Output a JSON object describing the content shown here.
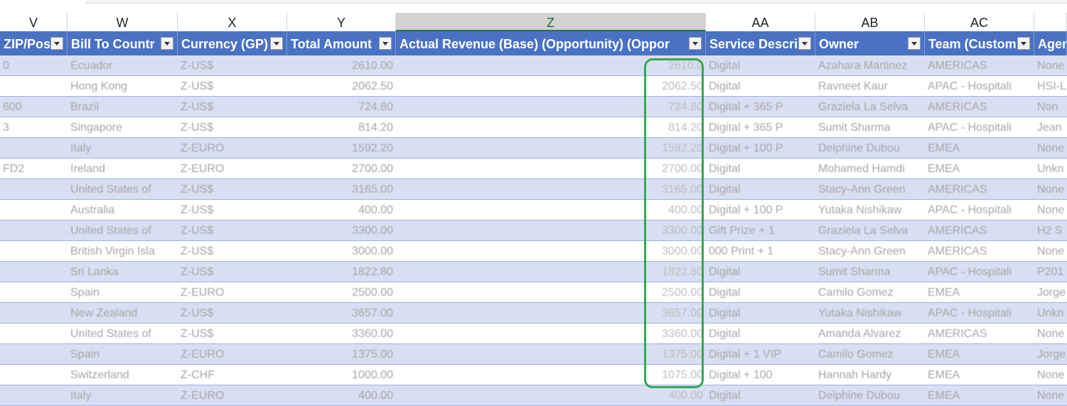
{
  "column_letters": [
    "V",
    "W",
    "X",
    "Y",
    "Z",
    "AA",
    "AB",
    "AC",
    ""
  ],
  "selected_column": "Z",
  "field_headers": [
    "ZIP/Pos",
    "Bill To Countr",
    "Currency (GP)",
    "Total Amount",
    "Actual Revenue (Base) (Opportunity) (Oppor",
    "Service Descri",
    "Owner",
    "Team (Custom",
    "Agen"
  ],
  "rows": [
    [
      "0",
      "Ecuador",
      "Z-US$",
      "2610.00",
      "",
      "2610.0",
      "Digital",
      "Azahara Martinez",
      "AMERICAS",
      "None"
    ],
    [
      "",
      "Hong Kong",
      "Z-US$",
      "2062.50",
      "",
      "2062.50",
      "Digital",
      "Ravneet Kaur",
      "APAC - Hospitali",
      "HSI-L"
    ],
    [
      "600",
      "Brazil",
      "Z-US$",
      "724.80",
      "",
      "724.80",
      "Digital + 365 P",
      "Graziela La Selva",
      "AMERICAS",
      "Non"
    ],
    [
      "3",
      "Singapore",
      "Z-US$",
      "814.20",
      "",
      "814.20",
      "Digital + 365 P",
      "Sumit Sharma",
      "APAC - Hospitali",
      "Jean"
    ],
    [
      "",
      "Italy",
      "Z-EURO",
      "1592.20",
      "",
      "1592.20",
      "Digital + 100 P",
      "Delphine Dubou",
      "EMEA",
      "None"
    ],
    [
      "FD2",
      "Ireland",
      "Z-EURO",
      "2700.00",
      "",
      "2700.00",
      "Digital",
      "Mohamed Hamdi",
      "EMEA",
      "Unkn"
    ],
    [
      "",
      "United States of",
      "Z-US$",
      "3165.00",
      "",
      "3165.00",
      "Digital",
      "Stacy-Ann Green",
      "AMERICAS",
      "None"
    ],
    [
      "",
      "Australia",
      "Z-US$",
      "400.00",
      "",
      "400.00",
      "Digital + 100 P",
      "Yutaka Nishikaw",
      "APAC - Hospitali",
      "None"
    ],
    [
      "",
      "United States of",
      "Z-US$",
      "3300.00",
      "",
      "3300.00",
      "Gift Prize + 1",
      "Graziela La Selva",
      "AMERICAS",
      "H2 S"
    ],
    [
      "",
      "British Virgin Isla",
      "Z-US$",
      "3000.00",
      "",
      "3000.00",
      "000 Print + 1",
      "Stacy-Ann Green",
      "AMERICAS",
      "None"
    ],
    [
      "",
      "Sri Lanka",
      "Z-US$",
      "1822.80",
      "",
      "1822.80",
      "Digital",
      "Sumit Sharma",
      "APAC - Hospitali",
      "P201"
    ],
    [
      "",
      "Spain",
      "Z-EURO",
      "2500.00",
      "",
      "2500.00",
      "Digital",
      "Camilo Gomez",
      "EMEA",
      "Jorge"
    ],
    [
      "",
      "New Zealand",
      "Z-US$",
      "3657.00",
      "",
      "3657.00",
      "Digital",
      "Yutaka Nishikaw",
      "APAC - Hospitali",
      "Unkn"
    ],
    [
      "",
      "United States of",
      "Z-US$",
      "3360.00",
      "",
      "3360.00",
      "Digital",
      "Amanda Alvarez",
      "AMERICAS",
      "None"
    ],
    [
      "",
      "Spain",
      "Z-EURO",
      "1375.00",
      "",
      "1375.00",
      "Digital + 1 VIP",
      "Camilo Gomez",
      "EMEA",
      "Jorge"
    ],
    [
      "",
      "Switzerland",
      "Z-CHF",
      "1000.00",
      "",
      "1075.00",
      "Digital + 100",
      "Hannah Hardy",
      "EMEA",
      "None"
    ],
    [
      "",
      "Italy",
      "Z-EURO",
      "400.00",
      "",
      "400.00",
      "Digital",
      "Delphine Dubou",
      "EMEA",
      "None"
    ]
  ],
  "highlight_color": "#34a853",
  "header_color": "#4a72c4",
  "band_color": "#d9dff2"
}
